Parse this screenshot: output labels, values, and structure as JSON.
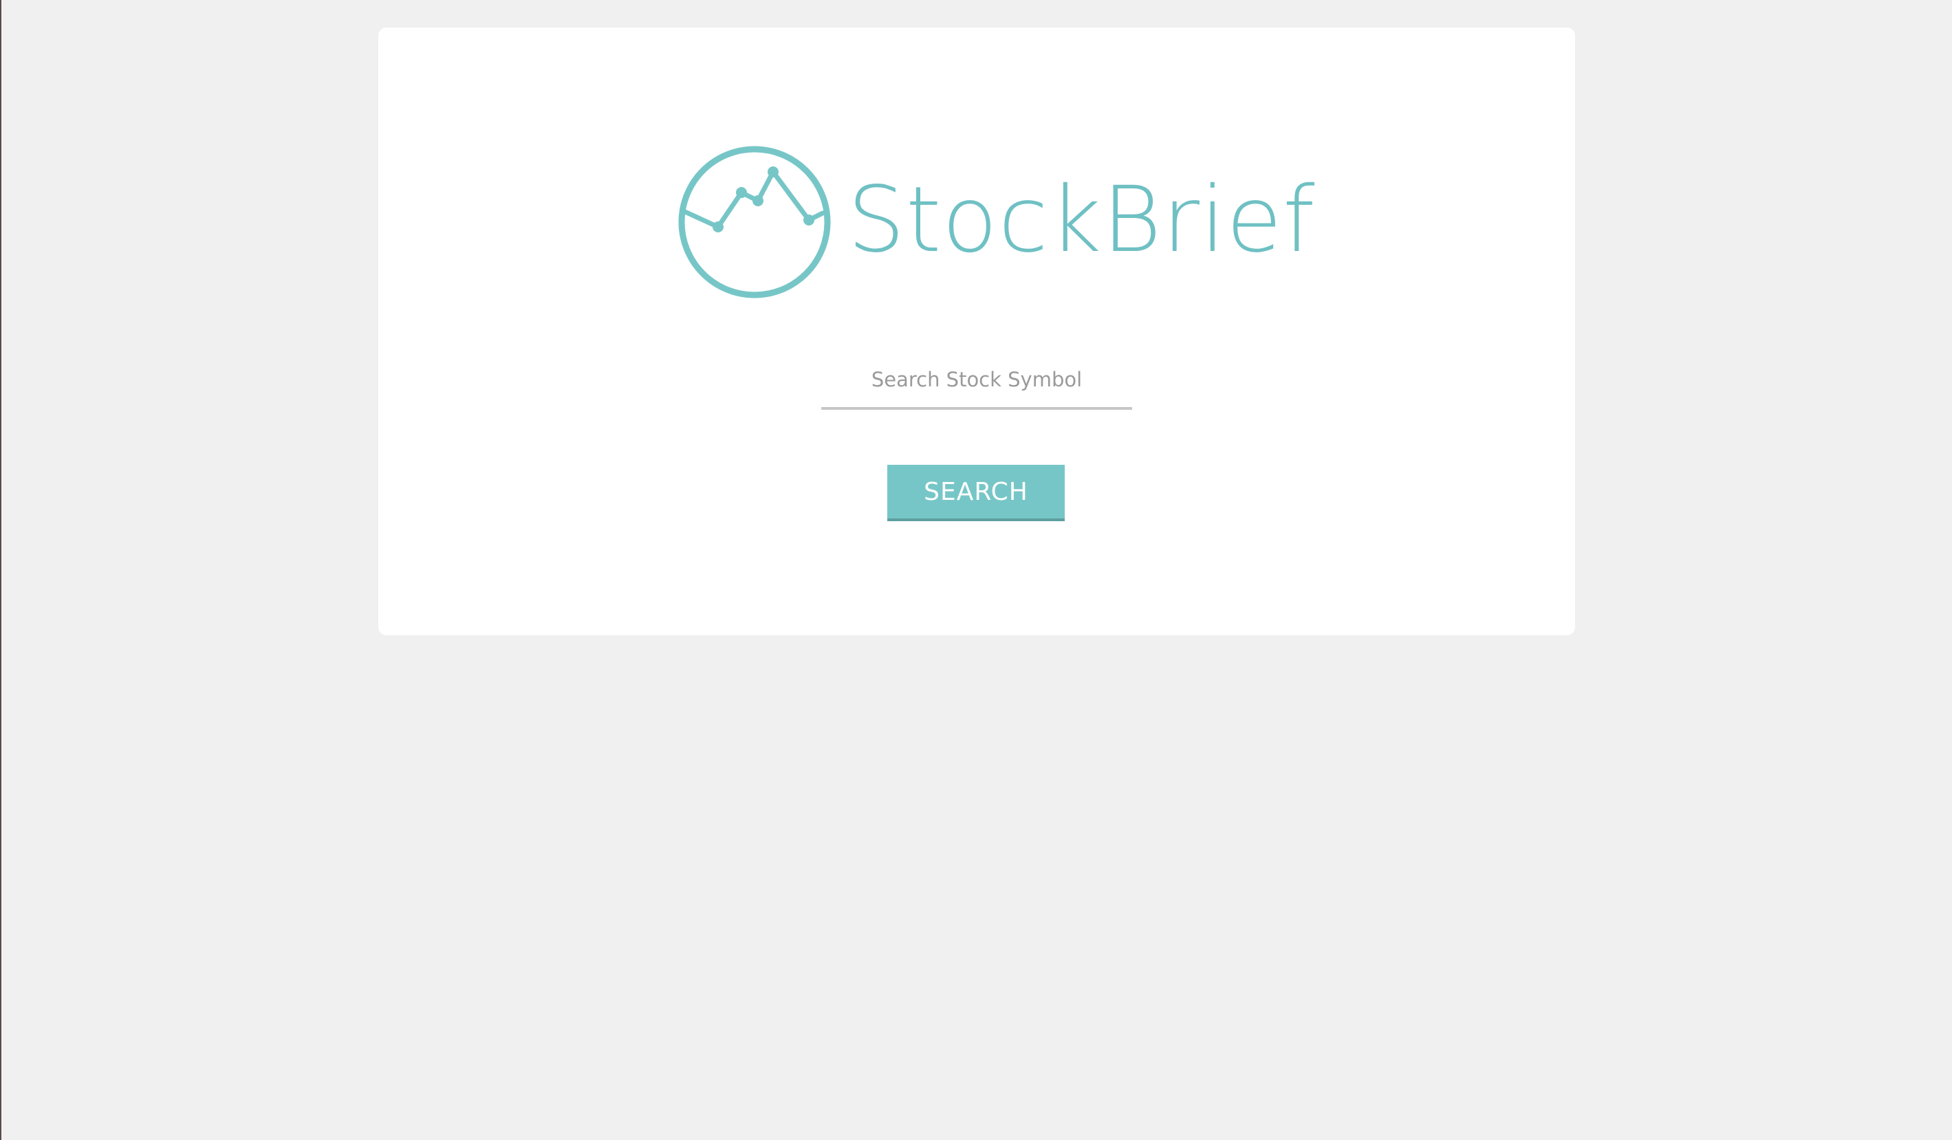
{
  "brand": {
    "name": "StockBrief",
    "accent_color": "#6fc0c3",
    "logo_icon": "stock-chart-circle-icon"
  },
  "search": {
    "placeholder": "Search Stock Symbol",
    "value": "",
    "button_label": "SEARCH",
    "button_color": "#77c6c7"
  },
  "page": {
    "background_color": "#f0f0f0",
    "card_color": "#ffffff"
  }
}
